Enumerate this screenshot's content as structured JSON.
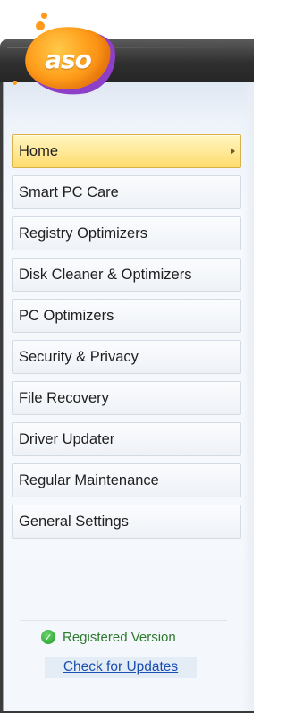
{
  "app": {
    "logo_text": "aso"
  },
  "sidebar": {
    "items": [
      {
        "label": "Home",
        "active": true
      },
      {
        "label": "Smart PC Care"
      },
      {
        "label": "Registry Optimizers"
      },
      {
        "label": "Disk Cleaner & Optimizers"
      },
      {
        "label": "PC Optimizers"
      },
      {
        "label": "Security & Privacy"
      },
      {
        "label": "File Recovery"
      },
      {
        "label": "Driver Updater"
      },
      {
        "label": "Regular Maintenance"
      },
      {
        "label": "General Settings"
      }
    ]
  },
  "footer": {
    "status_text": "Registered Version",
    "status_icon": "check-circle-icon",
    "update_link": "Check for Updates"
  },
  "colors": {
    "active_item": "#ffe690",
    "status_green": "#2e7a2e",
    "link_blue": "#1a4fb0",
    "logo_orange": "#ff9f1c",
    "logo_purple": "#8e3fc8"
  }
}
